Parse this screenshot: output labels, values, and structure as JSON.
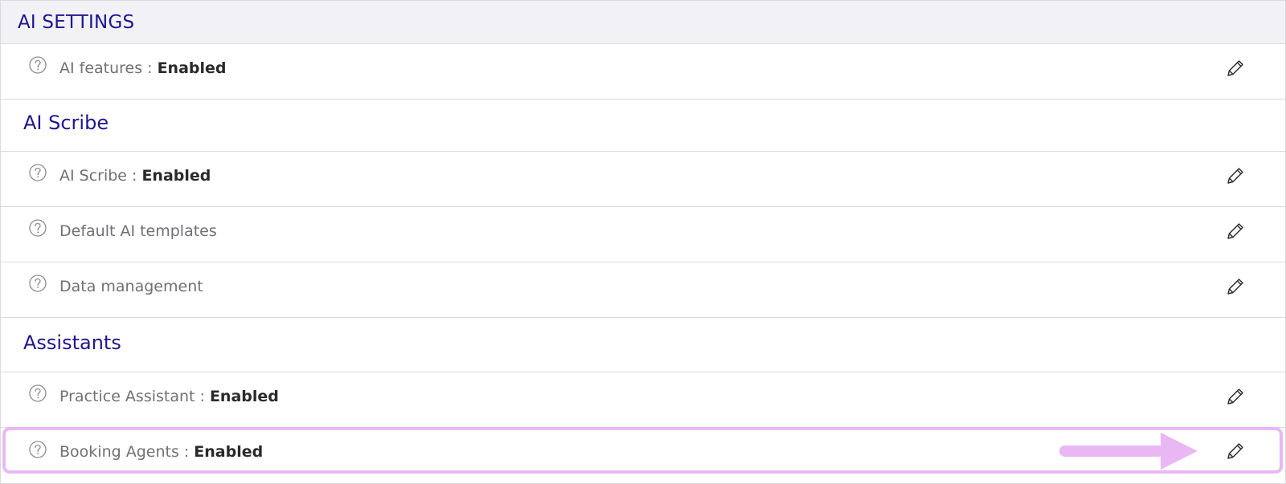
{
  "header": {
    "title": "AI SETTINGS"
  },
  "rows": {
    "ai_features": {
      "label": "AI features :",
      "value": "Enabled"
    },
    "ai_scribe": {
      "label": "AI Scribe :",
      "value": "Enabled"
    },
    "default_templates": {
      "label": "Default AI templates"
    },
    "data_management": {
      "label": "Data management"
    },
    "practice_assistant": {
      "label": "Practice Assistant :",
      "value": "Enabled"
    },
    "booking_agents": {
      "label": "Booking Agents :",
      "value": "Enabled"
    }
  },
  "sections": {
    "ai_scribe": "AI Scribe",
    "assistants": "Assistants"
  },
  "icons": {
    "help": "help-circle-icon",
    "edit": "pencil-icon",
    "annotation": "arrow-right-icon"
  },
  "colors": {
    "heading": "#1e1590",
    "header_bg": "#f1f1f6",
    "highlight": "#e9b8f4",
    "label": "#707075",
    "value": "#2a2a2e"
  }
}
